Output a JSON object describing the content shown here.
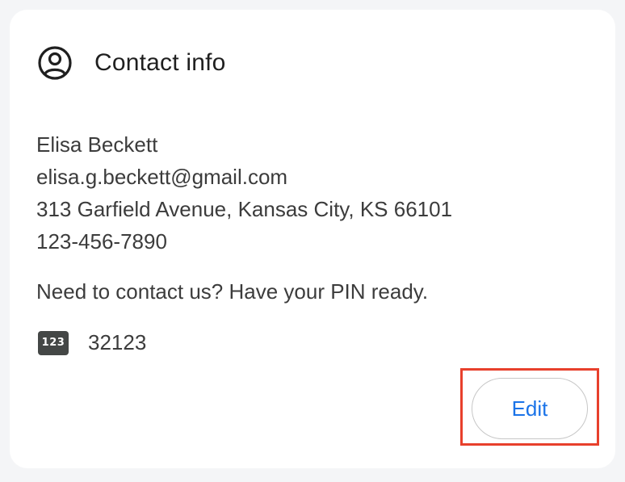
{
  "card": {
    "title": "Contact info",
    "title_icon": "account-circle-icon"
  },
  "contact": {
    "name": "Elisa Beckett",
    "email": "elisa.g.beckett@gmail.com",
    "address": "313 Garfield Avenue, Kansas City, KS 66101",
    "phone": "123-456-7890"
  },
  "pin_section": {
    "notice": "Need to contact us? Have your PIN ready.",
    "icon_label": "123",
    "icon": "pin-icon",
    "pin": "32123"
  },
  "actions": {
    "edit_label": "Edit"
  },
  "colors": {
    "accent": "#1a73e8",
    "highlight": "#e8402c",
    "text": "#3c3c3c",
    "card_bg": "#ffffff",
    "page_bg": "#f4f5f7"
  }
}
